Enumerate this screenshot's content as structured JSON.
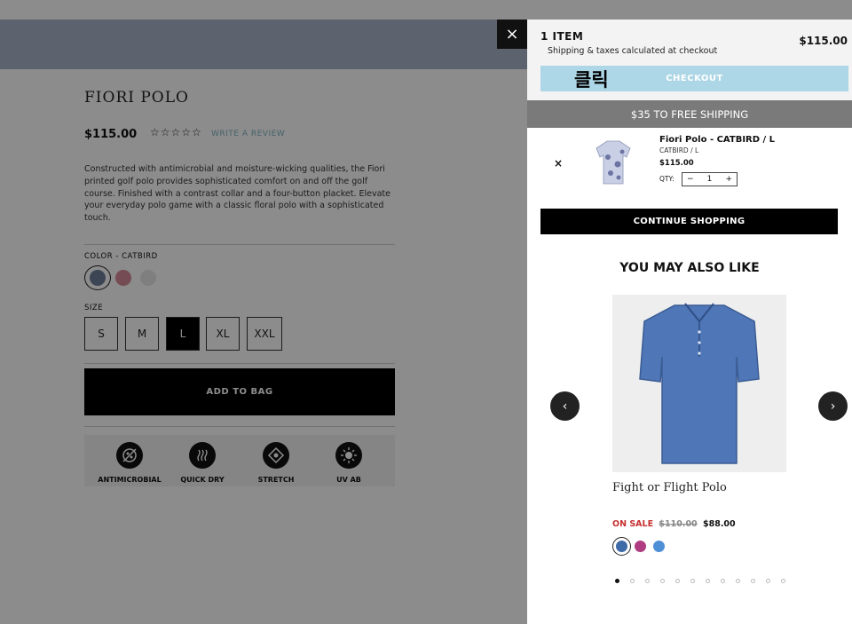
{
  "product": {
    "title": "FIORI POLO",
    "price": "$115.00",
    "rating_stars": "☆☆☆☆☆",
    "review_link": "WRITE A REVIEW",
    "description": "Constructed with antimicrobial and moisture-wicking qualities, the Fiori printed golf polo provides sophisticated comfort on and off the golf course. Finished with a contrast collar and a four-button placket. Elevate your everyday polo game with a classic floral polo with a sophisticated touch.",
    "color_label": "COLOR - CATBIRD",
    "colors": [
      "#6d7f99",
      "#d88a9a",
      "#e8e8e8"
    ],
    "size_label": "SIZE",
    "sizes": [
      "S",
      "M",
      "L",
      "XL",
      "XXL"
    ],
    "selected_size": "L",
    "add_to_bag": "ADD TO BAG",
    "features": [
      {
        "icon": "antimicrobial-icon",
        "label": "ANTIMICROBIAL"
      },
      {
        "icon": "quick-dry-icon",
        "label": "QUICK DRY"
      },
      {
        "icon": "stretch-icon",
        "label": "STRETCH"
      },
      {
        "icon": "uv-icon",
        "label": "UV AB"
      }
    ]
  },
  "cart": {
    "close": "×",
    "item_count": "1 ITEM",
    "shipping_note": "Shipping & taxes calculated at checkout",
    "subtotal": "$115.00",
    "checkout_label": "CHECKOUT",
    "annotation": "클릭",
    "free_shipping": "$35 TO FREE SHIPPING",
    "line_item": {
      "remove": "×",
      "name": "Fiori Polo - CATBIRD / L",
      "variant": "CATBIRD / L",
      "price": "$115.00",
      "qty_label": "QTY:",
      "qty_minus": "−",
      "qty": "1",
      "qty_plus": "+"
    },
    "continue_shopping": "CONTINUE SHOPPING",
    "recommendations": {
      "title": "YOU MAY ALSO LIKE",
      "prev_icon": "‹",
      "next_icon": "›",
      "product_name": "Fight or Flight Polo",
      "sale_label": "ON SALE",
      "old_price": "$110.00",
      "new_price": "$88.00",
      "swatches": [
        "#3f6aa8",
        "#b03c82",
        "#4f8fd6"
      ],
      "dot_count": 12,
      "active_dot": 0
    }
  },
  "colors": {
    "hero": "#a9b5c8",
    "checkout": "#add6e6",
    "free_shipping_bar": "#7a7a7a",
    "sale": "#c62f2f"
  }
}
